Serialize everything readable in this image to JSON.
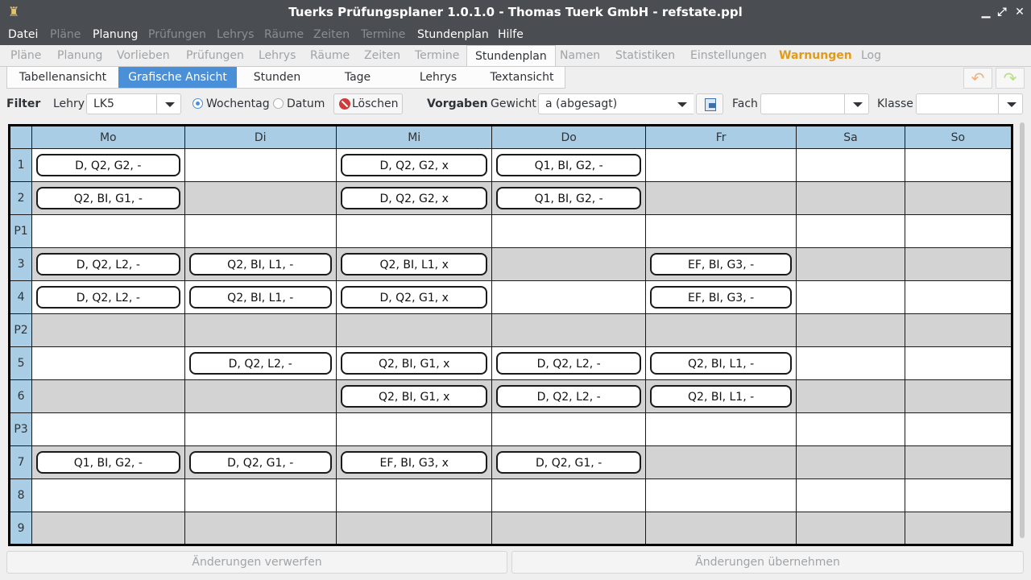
{
  "window": {
    "title": "Tuerks Prüfungsplaner 1.0.1.0 - Thomas Tuerk GmbH - refstate.ppl",
    "minimize": "▁",
    "maximize": "⤢",
    "close": "✕"
  },
  "menu": [
    "Datei",
    "Pläne",
    "Planung",
    "Prüfungen",
    "Lehrys",
    "Räume",
    "Zeiten",
    "Termine",
    "Stundenplan",
    "Hilfe"
  ],
  "tabs": [
    "Pläne",
    "Planung",
    "Vorlieben",
    "Prüfungen",
    "Lehrys",
    "Räume",
    "Zeiten",
    "Termine",
    "Stundenplan",
    "Namen",
    "Statistiken",
    "Einstellungen",
    "Warnungen",
    "Log"
  ],
  "views": [
    "Tabellenansicht",
    "Grafische Ansicht",
    "Stunden",
    "Tage",
    "Lehrys",
    "Textansicht"
  ],
  "filter": {
    "label": "Filter",
    "lehry_label": "Lehry",
    "lehry_value": "LK5",
    "radio_wochentag": "Wochentag",
    "radio_datum": "Datum",
    "loeschen": "Löschen"
  },
  "vorgaben": {
    "label": "Vorgaben",
    "gewicht_label": "Gewicht",
    "gewicht_value": "a (abgesagt)",
    "fach_label": "Fach",
    "fach_value": "",
    "klasse_label": "Klasse",
    "klasse_value": ""
  },
  "grid": {
    "days": [
      "Mo",
      "Di",
      "Mi",
      "Do",
      "Fr",
      "Sa",
      "So"
    ],
    "periods": [
      "1",
      "2",
      "P1",
      "3",
      "4",
      "P2",
      "5",
      "6",
      "P3",
      "7",
      "8",
      "9"
    ],
    "cells": [
      [
        "D, Q2, G2, -",
        "",
        "D, Q2, G2, x",
        "Q1, BI, G2, -",
        "",
        "",
        ""
      ],
      [
        "Q2, BI, G1, -",
        "",
        "D, Q2, G2, x",
        "Q1, BI, G2, -",
        "",
        "",
        ""
      ],
      [
        "",
        "",
        "",
        "",
        "",
        "",
        ""
      ],
      [
        "D, Q2, L2, -",
        "Q2, BI, L1, -",
        "Q2, BI, L1, x",
        "",
        "EF, BI, G3, -",
        "",
        ""
      ],
      [
        "D, Q2, L2, -",
        "Q2, BI, L1, -",
        "D, Q2, G1, x",
        "",
        "EF, BI, G3, -",
        "",
        ""
      ],
      [
        "",
        "",
        "",
        "",
        "",
        "",
        ""
      ],
      [
        "",
        "D, Q2, L2, -",
        "Q2, BI, G1, x",
        "D, Q2, L2, -",
        "Q2, BI, L1, -",
        "",
        ""
      ],
      [
        "",
        "",
        "Q2, BI, G1, x",
        "D, Q2, L2, -",
        "Q2, BI, L1, -",
        "",
        ""
      ],
      [
        "",
        "",
        "",
        "",
        "",
        "",
        ""
      ],
      [
        "Q1, BI, G2, -",
        "D, Q2, G1, -",
        "EF, BI, G3, x",
        "D, Q2, G1, -",
        "",
        "",
        ""
      ],
      [
        "",
        "",
        "",
        "",
        "",
        "",
        ""
      ],
      [
        "",
        "",
        "",
        "",
        "",
        "",
        ""
      ]
    ]
  },
  "footer": {
    "discard": "Änderungen verwerfen",
    "apply": "Änderungen übernehmen"
  }
}
